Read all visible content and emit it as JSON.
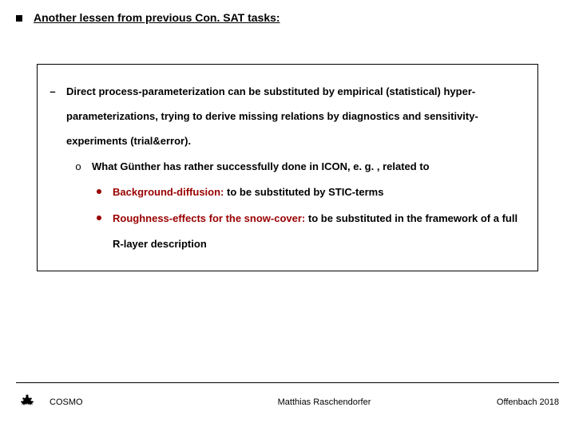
{
  "title": "Another lessen from previous Con. SAT tasks:",
  "box": {
    "dash": "Direct process-parameterization can be substituted by empirical (statistical) hyper-parameterizations, trying to derive missing relations by diagnostics and sensitivity-experiments (trial&error).",
    "circ": "What Günther has rather successfully done in ICON, e. g. , related to",
    "b1_head": "Background-diffusion:",
    "b1_tail": "  to be substituted by STIC-terms",
    "b2_head": "Roughness-effects for the snow-cover:",
    "b2_tail": " to be substituted in the framework of a full R-layer description"
  },
  "footer": {
    "left": "COSMO",
    "center": "Matthias Raschendorfer",
    "right": "Offenbach 2018"
  }
}
